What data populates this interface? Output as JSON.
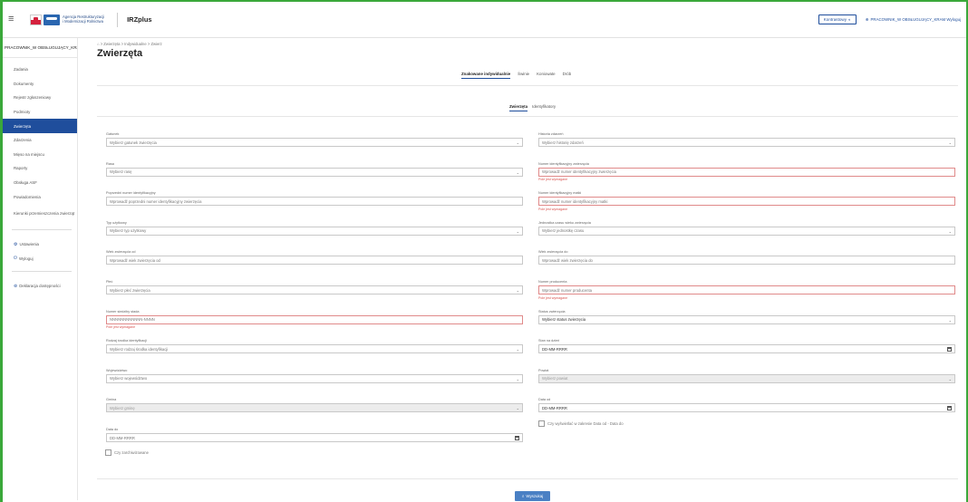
{
  "topbar": {
    "logo_text_line1": "Agencja Restrukturyzacji",
    "logo_text_line2": "i Modernizacji Rolnictwa",
    "app_name": "IRZplus",
    "contrast_label": "Kontrastowy",
    "user_label": "PRACOWNIK_W OBSŁUGUJĄCY_KRAM Wyloguj"
  },
  "sidebar": {
    "user": "PRACOWNIK_W OBSŁUGUJĄCY_KRAM",
    "items": [
      {
        "label": "Zadania"
      },
      {
        "label": "Dokumenty"
      },
      {
        "label": "Rejestr zgłoszeniowy"
      },
      {
        "label": "Podmioty"
      },
      {
        "label": "Zwierzęta"
      },
      {
        "label": "Zdarzenia"
      },
      {
        "label": "Mięso na miejscu"
      },
      {
        "label": "Raporty"
      },
      {
        "label": "Obsługa ASF"
      },
      {
        "label": "Powiadomienia"
      },
      {
        "label": "Kierunki przemieszczenia zwierząt"
      }
    ],
    "settings": "Ustawienia",
    "logout": "Wyloguj",
    "accessibility": "Deklaracja dostępności"
  },
  "breadcrumb": "⌂ > Zwierzęta > Indywidualne > Zwierz",
  "page_title": "Zwierzęta",
  "tabs_main": [
    "Znakowane indywidualnie",
    "Świnie",
    "Koniowate",
    "Drób"
  ],
  "tabs_sub": [
    "Zwierzęta",
    "Identyfikatory"
  ],
  "error_required": "Pole jest wymagane",
  "fields_left": [
    {
      "label": "Gatunek",
      "placeholder": "Wybierz gatunek zwierzęcia",
      "type": "select"
    },
    {
      "label": "Rasa",
      "placeholder": "Wybierz rasę",
      "type": "select"
    },
    {
      "label": "Poprzedni numer identyfikacyjny",
      "placeholder": "Wprowadź poprzedni numer identyfikacyjny zwierzęcia",
      "type": "text"
    },
    {
      "label": "Typ użytkowy",
      "placeholder": "Wybierz typ użytkowy",
      "type": "select"
    },
    {
      "label": "Wiek zwierzęcia od",
      "placeholder": "Wprowadź wiek zwierzęcia od",
      "type": "text"
    },
    {
      "label": "Płeć",
      "placeholder": "Wybierz płeć zwierzęcia",
      "type": "select"
    },
    {
      "label": "Numer siedziby stada",
      "placeholder": "NNNNNNNNNNNN-NNNN",
      "type": "text",
      "error": true
    },
    {
      "label": "Rodzaj środka identyfikacji",
      "placeholder": "Wybierz rodzaj środka identyfikacji",
      "type": "select"
    },
    {
      "label": "Województwo",
      "placeholder": "Wybierz województwo",
      "type": "select"
    },
    {
      "label": "Gmina",
      "placeholder": "Wybierz gminę",
      "type": "select",
      "disabled": true
    },
    {
      "label": "Data do",
      "placeholder": "DD-MM-RRRR",
      "type": "date"
    }
  ],
  "fields_right": [
    {
      "label": "Historia zdarzeń",
      "placeholder": "Wybierz historię zdarzeń",
      "type": "select"
    },
    {
      "label": "Numer identyfikacyjny zwierzęcia",
      "placeholder": "Wprowadź numer identyfikacyjny zwierzęcia",
      "type": "text",
      "error": true
    },
    {
      "label": "Numer identyfikacyjny matki",
      "placeholder": "Wprowadź numer identyfikacyjny matki",
      "type": "text",
      "error": true
    },
    {
      "label": "Jednostka czasu wieku zwierzęcia",
      "placeholder": "Wybierz jednostkę czasu",
      "type": "select"
    },
    {
      "label": "Wiek zwierzęcia do",
      "placeholder": "Wprowadź wiek zwierzęcia do",
      "type": "text"
    },
    {
      "label": "Numer producenta",
      "placeholder": "Wprowadź numer producenta",
      "type": "text",
      "error": true
    },
    {
      "label": "Status zwierzęcia",
      "placeholder": "Wybierz status zwierzęcia",
      "type": "select",
      "dark": true
    },
    {
      "label": "Stan na dzień",
      "placeholder": "DD-MM-RRRR",
      "type": "date",
      "dark": true
    },
    {
      "label": "Powiat",
      "placeholder": "Wybierz powiat",
      "type": "select",
      "disabled": true
    },
    {
      "label": "Data od",
      "placeholder": "DD-MM-RRRR",
      "type": "date",
      "dark": true
    }
  ],
  "checkbox_range": "Czy wyświetlać w zakresie Data od - Data do",
  "checkbox_archived": "Czy zarchiwizowane",
  "search_label": "Wyszukaj"
}
